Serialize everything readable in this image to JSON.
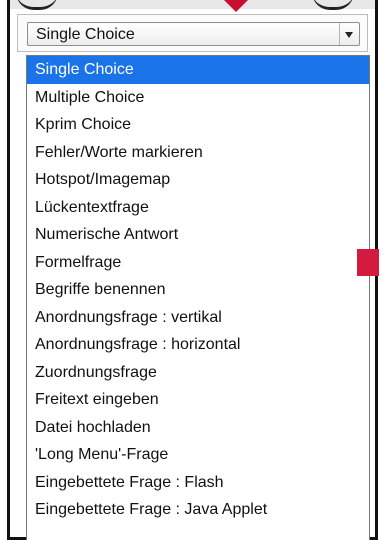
{
  "select": {
    "value": "Single Choice"
  },
  "dropdown": {
    "options": [
      "Single Choice",
      "Multiple Choice",
      "Kprim Choice",
      "Fehler/Worte markieren",
      "Hotspot/Imagemap",
      "Lückentextfrage",
      "Numerische Antwort",
      "Formelfrage",
      "Begriffe benennen",
      "Anordnungsfrage : vertikal",
      "Anordnungsfrage : horizontal",
      "Zuordnungsfrage",
      "Freitext eingeben",
      "Datei hochladen",
      "'Long Menu'-Frage",
      "Eingebettete Frage : Flash",
      "Eingebettete Frage : Java Applet"
    ],
    "selected_index": 0
  },
  "colors": {
    "selection": "#1a73e8",
    "annotation_red": "#c8102e",
    "marker_red": "#d31c3d"
  }
}
